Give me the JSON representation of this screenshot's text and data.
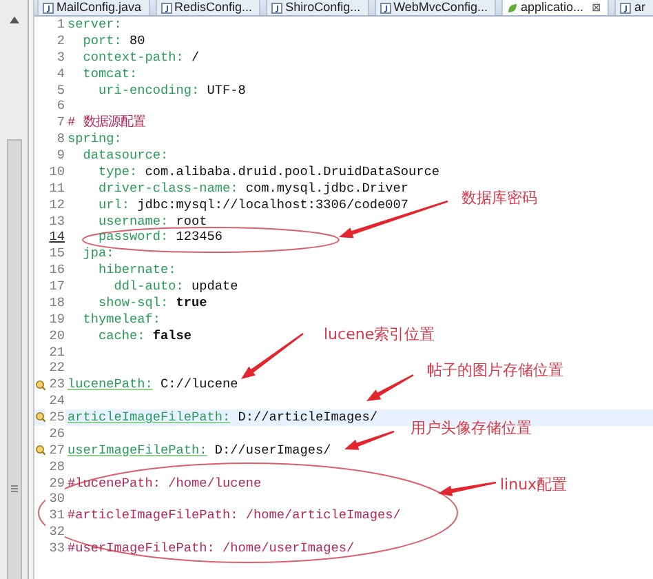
{
  "tabs": [
    {
      "label": "MailConfig.java",
      "kind": "java",
      "selected": false
    },
    {
      "label": "RedisConfig...",
      "kind": "java",
      "selected": false
    },
    {
      "label": "ShiroConfig...",
      "kind": "java",
      "selected": false
    },
    {
      "label": "WebMvcConfig...",
      "kind": "java",
      "selected": false
    },
    {
      "label": "applicatio...",
      "kind": "yaml",
      "selected": true,
      "close": "⊠"
    },
    {
      "label": "ar",
      "kind": "java",
      "selected": false
    }
  ],
  "lines": [
    {
      "number": "1",
      "current": false,
      "warning": false,
      "marked": false,
      "tokens": [
        {
          "text": "server:",
          "kind": "key"
        }
      ]
    },
    {
      "number": "2",
      "current": false,
      "warning": false,
      "marked": false,
      "tokens": [
        {
          "text": "  port:",
          "kind": "key"
        },
        {
          "text": " 80",
          "kind": "value"
        }
      ]
    },
    {
      "number": "3",
      "current": false,
      "warning": false,
      "marked": false,
      "tokens": [
        {
          "text": "  context-path:",
          "kind": "key"
        },
        {
          "text": " /",
          "kind": "value"
        }
      ]
    },
    {
      "number": "4",
      "current": false,
      "warning": false,
      "marked": false,
      "tokens": [
        {
          "text": "  tomcat:",
          "kind": "key"
        }
      ]
    },
    {
      "number": "5",
      "current": false,
      "warning": false,
      "marked": false,
      "tokens": [
        {
          "text": "    uri-encoding:",
          "kind": "key"
        },
        {
          "text": " UTF-8",
          "kind": "value"
        }
      ]
    },
    {
      "number": "6",
      "current": false,
      "warning": false,
      "marked": false
    },
    {
      "number": "7",
      "current": false,
      "warning": false,
      "marked": false,
      "tokens": [
        {
          "text": "# 数据源配置",
          "kind": "comment"
        }
      ]
    },
    {
      "number": "8",
      "current": false,
      "warning": false,
      "marked": false,
      "tokens": [
        {
          "text": "spring:",
          "kind": "key"
        }
      ]
    },
    {
      "number": "9",
      "current": false,
      "warning": false,
      "marked": false,
      "tokens": [
        {
          "text": "  datasource:",
          "kind": "key"
        }
      ]
    },
    {
      "number": "10",
      "current": false,
      "warning": false,
      "marked": false,
      "tokens": [
        {
          "text": "    type:",
          "kind": "key"
        },
        {
          "text": " com.alibaba.druid.pool.DruidDataSource",
          "kind": "value"
        }
      ]
    },
    {
      "number": "11",
      "current": false,
      "warning": false,
      "marked": false,
      "tokens": [
        {
          "text": "    driver-class-name:",
          "kind": "key"
        },
        {
          "text": " com.mysql.jdbc.Driver",
          "kind": "value"
        }
      ]
    },
    {
      "number": "12",
      "current": false,
      "warning": false,
      "marked": false,
      "tokens": [
        {
          "text": "    url:",
          "kind": "key"
        },
        {
          "text": " jdbc:mysql://localhost:3306/code007",
          "kind": "value"
        }
      ]
    },
    {
      "number": "13",
      "current": false,
      "warning": false,
      "marked": false,
      "tokens": [
        {
          "text": "    username:",
          "kind": "key"
        },
        {
          "text": " root",
          "kind": "value"
        }
      ]
    },
    {
      "number": "14",
      "current": false,
      "warning": false,
      "marked": true,
      "tokens": [
        {
          "text": "    password:",
          "kind": "key"
        },
        {
          "text": " 123456",
          "kind": "value"
        }
      ]
    },
    {
      "number": "15",
      "current": false,
      "warning": false,
      "marked": false,
      "tokens": [
        {
          "text": "  jpa:",
          "kind": "key"
        }
      ]
    },
    {
      "number": "16",
      "current": false,
      "warning": false,
      "marked": false,
      "tokens": [
        {
          "text": "    hibernate:",
          "kind": "key"
        }
      ]
    },
    {
      "number": "17",
      "current": false,
      "warning": false,
      "marked": false,
      "tokens": [
        {
          "text": "      ddl-auto:",
          "kind": "key"
        },
        {
          "text": " update",
          "kind": "value"
        }
      ]
    },
    {
      "number": "18",
      "current": false,
      "warning": false,
      "marked": false,
      "tokens": [
        {
          "text": "    show-sql:",
          "kind": "key"
        },
        {
          "text": " true",
          "kind": "bool"
        }
      ]
    },
    {
      "number": "19",
      "current": false,
      "warning": false,
      "marked": false,
      "tokens": [
        {
          "text": "  thymeleaf:",
          "kind": "key"
        }
      ]
    },
    {
      "number": "20",
      "current": false,
      "warning": false,
      "marked": false,
      "tokens": [
        {
          "text": "    cache:",
          "kind": "key"
        },
        {
          "text": " false",
          "kind": "bool"
        }
      ]
    },
    {
      "number": "21",
      "current": false,
      "warning": false,
      "marked": false
    },
    {
      "number": "22",
      "current": false,
      "warning": false,
      "marked": false
    },
    {
      "number": "23",
      "current": false,
      "warning": true,
      "marked": false,
      "tokens": [
        {
          "text": "lucenePath:",
          "kind": "key"
        },
        {
          "text": " C://lucene",
          "kind": "value"
        }
      ]
    },
    {
      "number": "24",
      "current": false,
      "warning": false,
      "marked": false
    },
    {
      "number": "25",
      "current": true,
      "warning": true,
      "marked": false,
      "tokens": [
        {
          "text": "articleImageFilePath:",
          "kind": "key"
        },
        {
          "text": " D://articleImages/",
          "kind": "value"
        }
      ]
    },
    {
      "number": "26",
      "current": false,
      "warning": false,
      "marked": false
    },
    {
      "number": "27",
      "current": false,
      "warning": true,
      "marked": false,
      "tokens": [
        {
          "text": "userImageFilePath:",
          "kind": "key"
        },
        {
          "text": " D://userImages/",
          "kind": "value"
        }
      ]
    },
    {
      "number": "28",
      "current": false,
      "warning": false,
      "marked": false
    },
    {
      "number": "29",
      "current": false,
      "warning": false,
      "marked": false,
      "tokens": [
        {
          "text": "#lucenePath: /home/lucene",
          "kind": "comment"
        }
      ]
    },
    {
      "number": "30",
      "current": false,
      "warning": false,
      "marked": false
    },
    {
      "number": "31",
      "current": false,
      "warning": false,
      "marked": false,
      "tokens": [
        {
          "text": "#articleImageFilePath: /home/articleImages/",
          "kind": "comment"
        }
      ]
    },
    {
      "number": "32",
      "current": false,
      "warning": false,
      "marked": false
    },
    {
      "number": "33",
      "current": false,
      "warning": false,
      "marked": false,
      "tokens": [
        {
          "text": "#userImageFilePath: /home/userImages/",
          "kind": "comment"
        }
      ]
    }
  ],
  "annotations": [
    {
      "text": "数据库密码"
    },
    {
      "text": "lucene索引位置"
    },
    {
      "text": "帖子的图片存储位置"
    },
    {
      "text": "用户头像存储位置"
    },
    {
      "text": "linux配置"
    }
  ]
}
